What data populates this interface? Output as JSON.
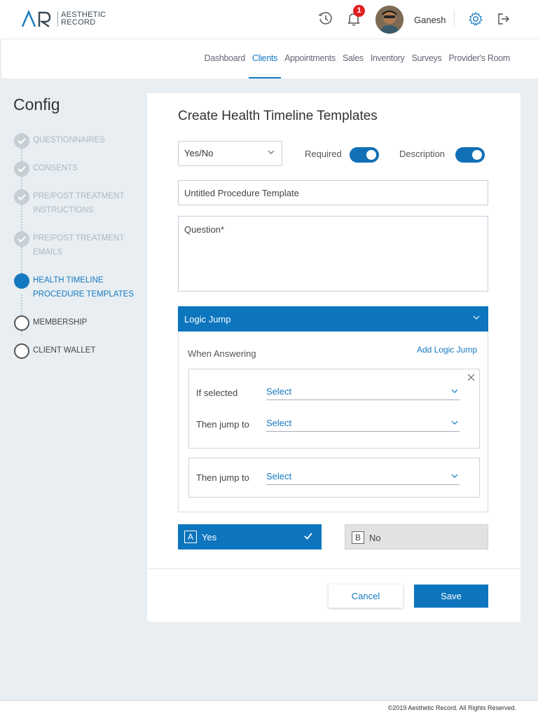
{
  "brand": {
    "logo_text_1": "AESTHETIC",
    "logo_text_2": "RECORD",
    "accent": "#1479bf"
  },
  "header": {
    "notifications_count": "1",
    "username": "Ganesh"
  },
  "nav": {
    "items": [
      "Dashboard",
      "Clients",
      "Appointments",
      "Sales",
      "Inventory",
      "Surveys",
      "Provider's Room"
    ],
    "active": "Clients"
  },
  "sidebar": {
    "title": "Config",
    "steps": [
      {
        "label": "QUESTIONNAIRES",
        "state": "done"
      },
      {
        "label": "CONSENTS",
        "state": "done"
      },
      {
        "label": "PRE/POST TREATMENT INSTRUCTIONS",
        "state": "done"
      },
      {
        "label": "PRE/POST TREATMENT EMAILS",
        "state": "done"
      },
      {
        "label": "HEALTH TIMELINE PROCEDURE TEMPLATES",
        "state": "active"
      },
      {
        "label": "MEMBERSHIP",
        "state": "todo"
      },
      {
        "label": "CLIENT WALLET",
        "state": "todo"
      }
    ]
  },
  "form": {
    "title": "Create Health Timeline Templates",
    "question_type": "Yes/No",
    "required_label": "Required",
    "required_on": true,
    "description_label": "Description",
    "description_on": true,
    "template_name": "Untitled Procedure Template",
    "question_placeholder": "Question*",
    "logic": {
      "header": "Logic Jump",
      "when_answering": "When Answering",
      "add_jump": "Add Logic Jump",
      "if_selected_label": "If selected",
      "then_jump_label": "Then jump to",
      "select_placeholder": "Select"
    },
    "answers": [
      {
        "letter": "A",
        "text": "Yes",
        "selected": true
      },
      {
        "letter": "B",
        "text": "No",
        "selected": false
      }
    ],
    "cancel_label": "Cancel",
    "save_label": "Save"
  },
  "footer": {
    "copyright": "©2019 Aesthetic Record. All Rights Reserved."
  }
}
